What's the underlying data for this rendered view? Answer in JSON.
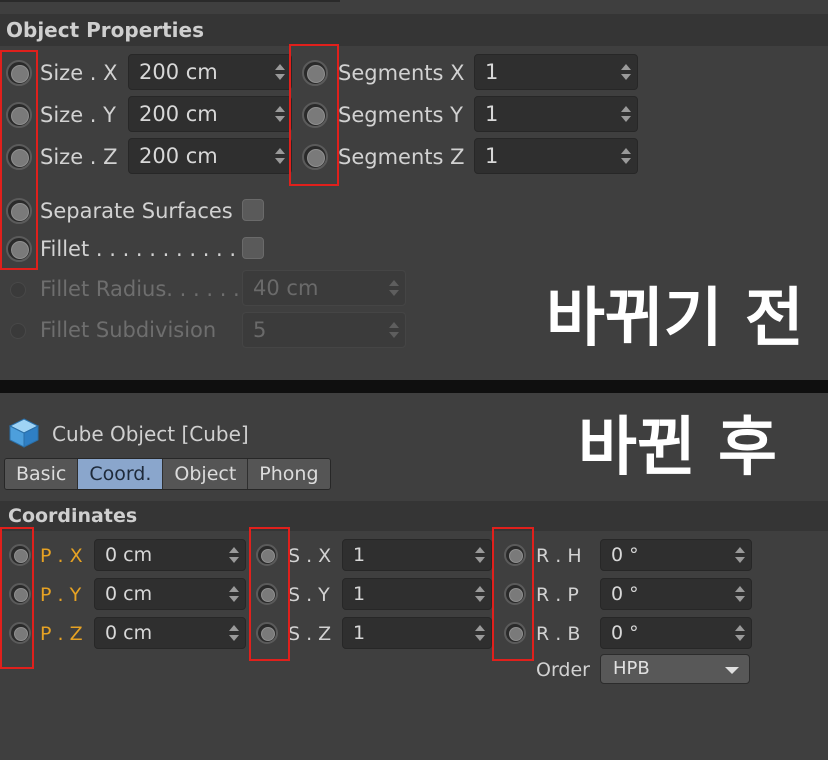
{
  "before": {
    "section_title": "Object Properties",
    "rows": [
      {
        "label": "Size . X",
        "value": "200 cm",
        "seg_label": "Segments X",
        "seg_value": "1"
      },
      {
        "label": "Size . Y",
        "value": "200 cm",
        "seg_label": "Segments Y",
        "seg_value": "1"
      },
      {
        "label": "Size . Z",
        "value": "200 cm",
        "seg_label": "Segments Z",
        "seg_value": "1"
      }
    ],
    "separate_surfaces": "Separate Surfaces",
    "fillet": "Fillet . . . . . . . . . . . .",
    "fillet_radius_label": "Fillet Radius. . . . . .",
    "fillet_radius_value": "40 cm",
    "fillet_subdivision_label": "Fillet Subdivision",
    "fillet_subdivision_value": "5",
    "caption": "바뀌기 전"
  },
  "after": {
    "object_title": "Cube Object [Cube]",
    "tabs": [
      "Basic",
      "Coord.",
      "Object",
      "Phong"
    ],
    "active_tab": "Coord.",
    "section_title": "Coordinates",
    "position": [
      {
        "label": "P . X",
        "value": "0 cm"
      },
      {
        "label": "P . Y",
        "value": "0 cm"
      },
      {
        "label": "P . Z",
        "value": "0 cm"
      }
    ],
    "scale": [
      {
        "label": "S . X",
        "value": "1"
      },
      {
        "label": "S . Y",
        "value": "1"
      },
      {
        "label": "S . Z",
        "value": "1"
      }
    ],
    "rotation": [
      {
        "label": "R . H",
        "value": "0 °"
      },
      {
        "label": "R . P",
        "value": "0 °"
      },
      {
        "label": "R . B",
        "value": "0 °"
      }
    ],
    "order_label": "Order",
    "order_value": "HPB",
    "caption": "바뀐 후"
  },
  "colors": {
    "highlight_box": "#e0201c",
    "active_tab": "#8aa6cc",
    "position_label": "#e6a223",
    "background": "#3f3f3f"
  },
  "icons": [
    "cube-icon",
    "animation-radio-icon",
    "spinner-arrows-icon",
    "dropdown-caret-icon"
  ]
}
